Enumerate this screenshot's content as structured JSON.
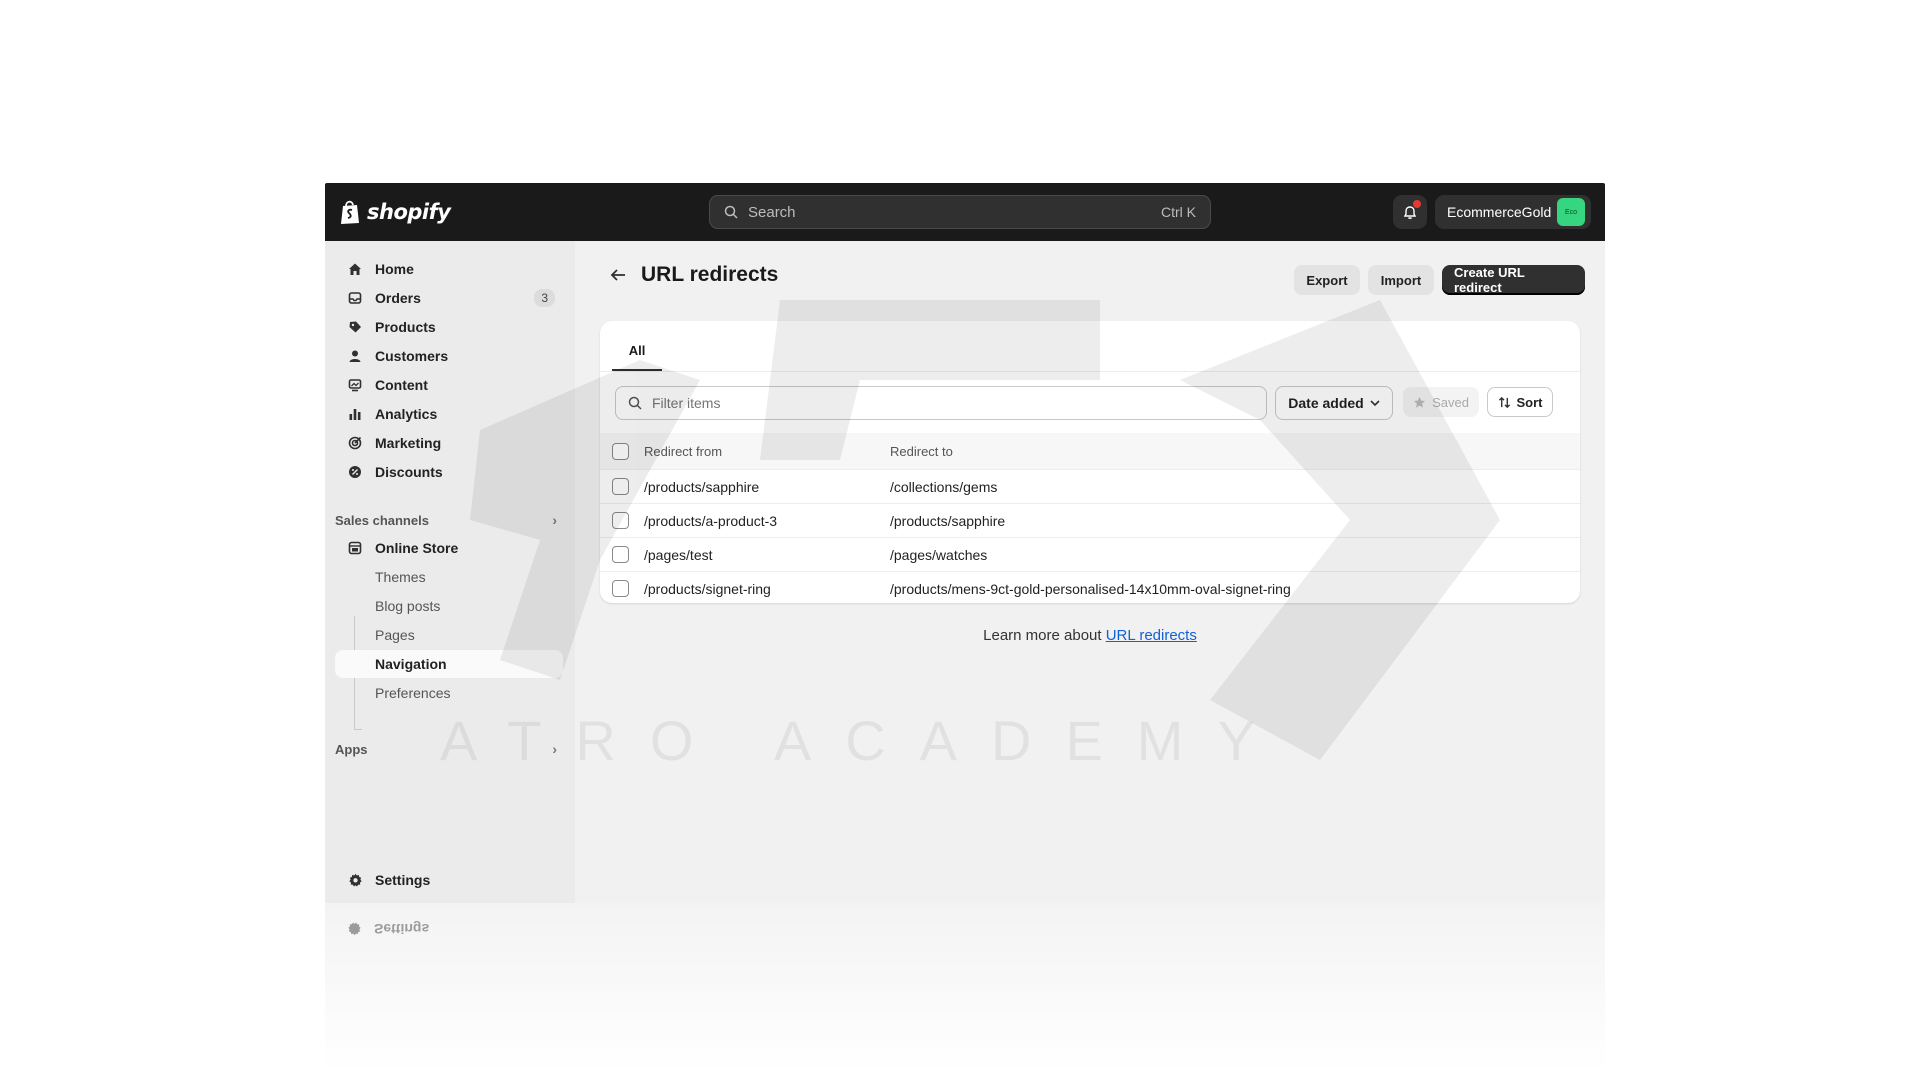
{
  "topbar": {
    "brand": "shopify",
    "search_placeholder": "Search",
    "search_shortcut": "Ctrl K",
    "store_name": "EcommerceGold",
    "store_avatar": "Eco",
    "accent_avatar_color": "#36d57f"
  },
  "sidebar": {
    "items": [
      {
        "label": "Home",
        "icon": "home-icon"
      },
      {
        "label": "Orders",
        "icon": "orders-icon",
        "badge": "3"
      },
      {
        "label": "Products",
        "icon": "tag-icon"
      },
      {
        "label": "Customers",
        "icon": "person-icon"
      },
      {
        "label": "Content",
        "icon": "content-icon"
      },
      {
        "label": "Analytics",
        "icon": "bar-chart-icon"
      },
      {
        "label": "Marketing",
        "icon": "target-icon"
      },
      {
        "label": "Discounts",
        "icon": "discount-icon"
      }
    ],
    "sales_channels_label": "Sales channels",
    "online_store_label": "Online Store",
    "online_store_sub": [
      {
        "label": "Themes"
      },
      {
        "label": "Blog posts"
      },
      {
        "label": "Pages"
      },
      {
        "label": "Navigation",
        "active": true
      },
      {
        "label": "Preferences"
      }
    ],
    "apps_label": "Apps",
    "settings_label": "Settings"
  },
  "main": {
    "title": "URL redirects",
    "export_label": "Export",
    "import_label": "Import",
    "create_label": "Create URL redirect",
    "tab_all": "All",
    "filter_placeholder": "Filter items",
    "date_added_label": "Date added",
    "saved_label": "Saved",
    "sort_label": "Sort",
    "columns": {
      "from": "Redirect from",
      "to": "Redirect to"
    },
    "rows": [
      {
        "from": "/products/sapphire",
        "to": "/collections/gems"
      },
      {
        "from": "/products/a-product-3",
        "to": "/products/sapphire"
      },
      {
        "from": "/pages/test",
        "to": "/pages/watches"
      },
      {
        "from": "/products/signet-ring",
        "to": "/products/mens-9ct-gold-personalised-14x10mm-oval-signet-ring"
      }
    ],
    "learn_more_prefix": "Learn more about ",
    "learn_more_link": "URL redirects"
  },
  "watermark_text": "ATRO ACADEMY",
  "colors": {
    "topbar_bg": "#1a1a1a",
    "primary_button": "#303030",
    "link": "#1060d6",
    "notification_dot": "#e53935"
  }
}
